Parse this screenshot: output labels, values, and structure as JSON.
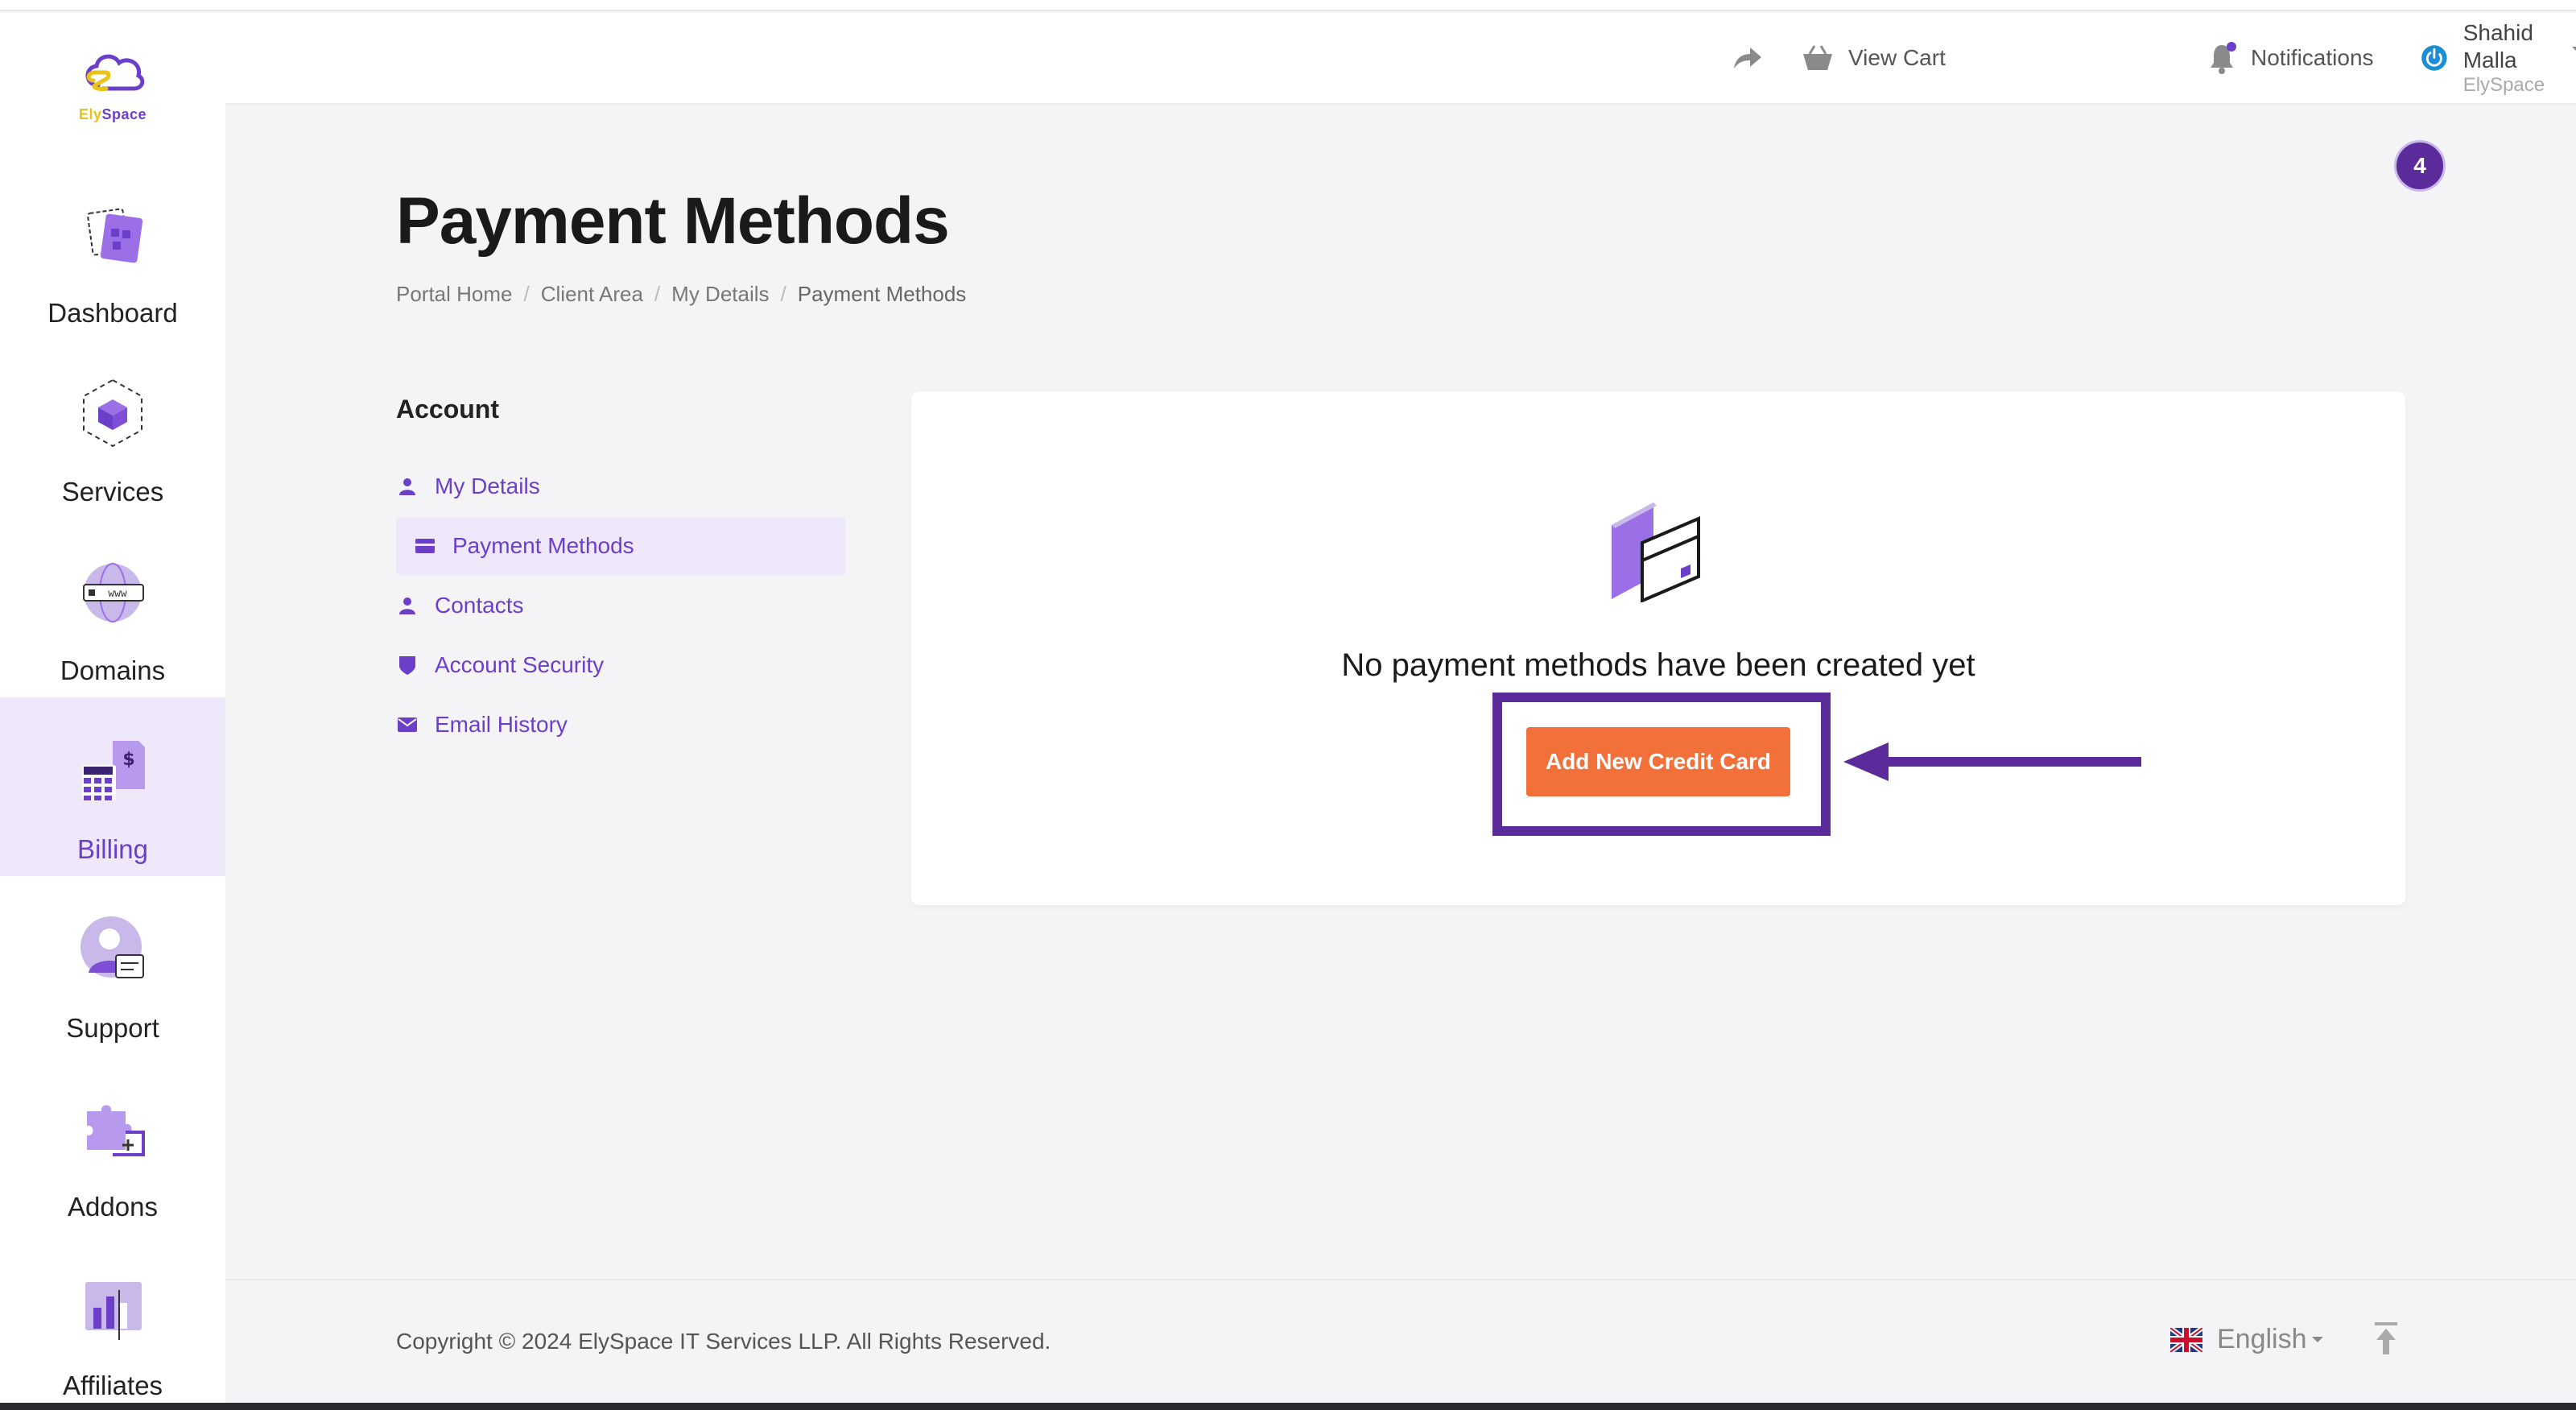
{
  "brand": {
    "logo_ely": "Ely",
    "logo_space": "Space"
  },
  "sidebar": {
    "items": [
      {
        "label": "Dashboard",
        "icon": "dashboard-icon"
      },
      {
        "label": "Services",
        "icon": "services-cube-icon"
      },
      {
        "label": "Domains",
        "icon": "globe-www-icon"
      },
      {
        "label": "Billing",
        "icon": "billing-calculator-icon",
        "active": true
      },
      {
        "label": "Support",
        "icon": "support-agent-icon"
      },
      {
        "label": "Addons",
        "icon": "puzzle-icon"
      },
      {
        "label": "Affiliates",
        "icon": "affiliates-chart-icon"
      }
    ]
  },
  "header": {
    "share_icon": "share-arrow-icon",
    "view_cart": "View Cart",
    "notifications": "Notifications",
    "user_name": "Shahid Malla",
    "user_org": "ElySpace"
  },
  "badge_count": "4",
  "page": {
    "title": "Payment Methods",
    "breadcrumb": [
      "Portal Home",
      "Client Area",
      "My Details",
      "Payment Methods"
    ]
  },
  "account": {
    "heading": "Account",
    "items": [
      {
        "label": "My Details",
        "icon": "user-icon"
      },
      {
        "label": "Payment Methods",
        "icon": "credit-card-icon",
        "active": true
      },
      {
        "label": "Contacts",
        "icon": "user-icon"
      },
      {
        "label": "Account Security",
        "icon": "shield-icon"
      },
      {
        "label": "Email History",
        "icon": "envelope-icon"
      }
    ]
  },
  "main": {
    "empty_message": "No payment methods have been created yet",
    "add_button": "Add New Credit Card"
  },
  "footer": {
    "copyright": "Copyright © 2024 ElySpace IT Services LLP. All Rights Reserved.",
    "language": "English"
  },
  "colors": {
    "accent": "#6b3fc7",
    "button": "#f2713a",
    "highlight": "#5b2a9b"
  }
}
